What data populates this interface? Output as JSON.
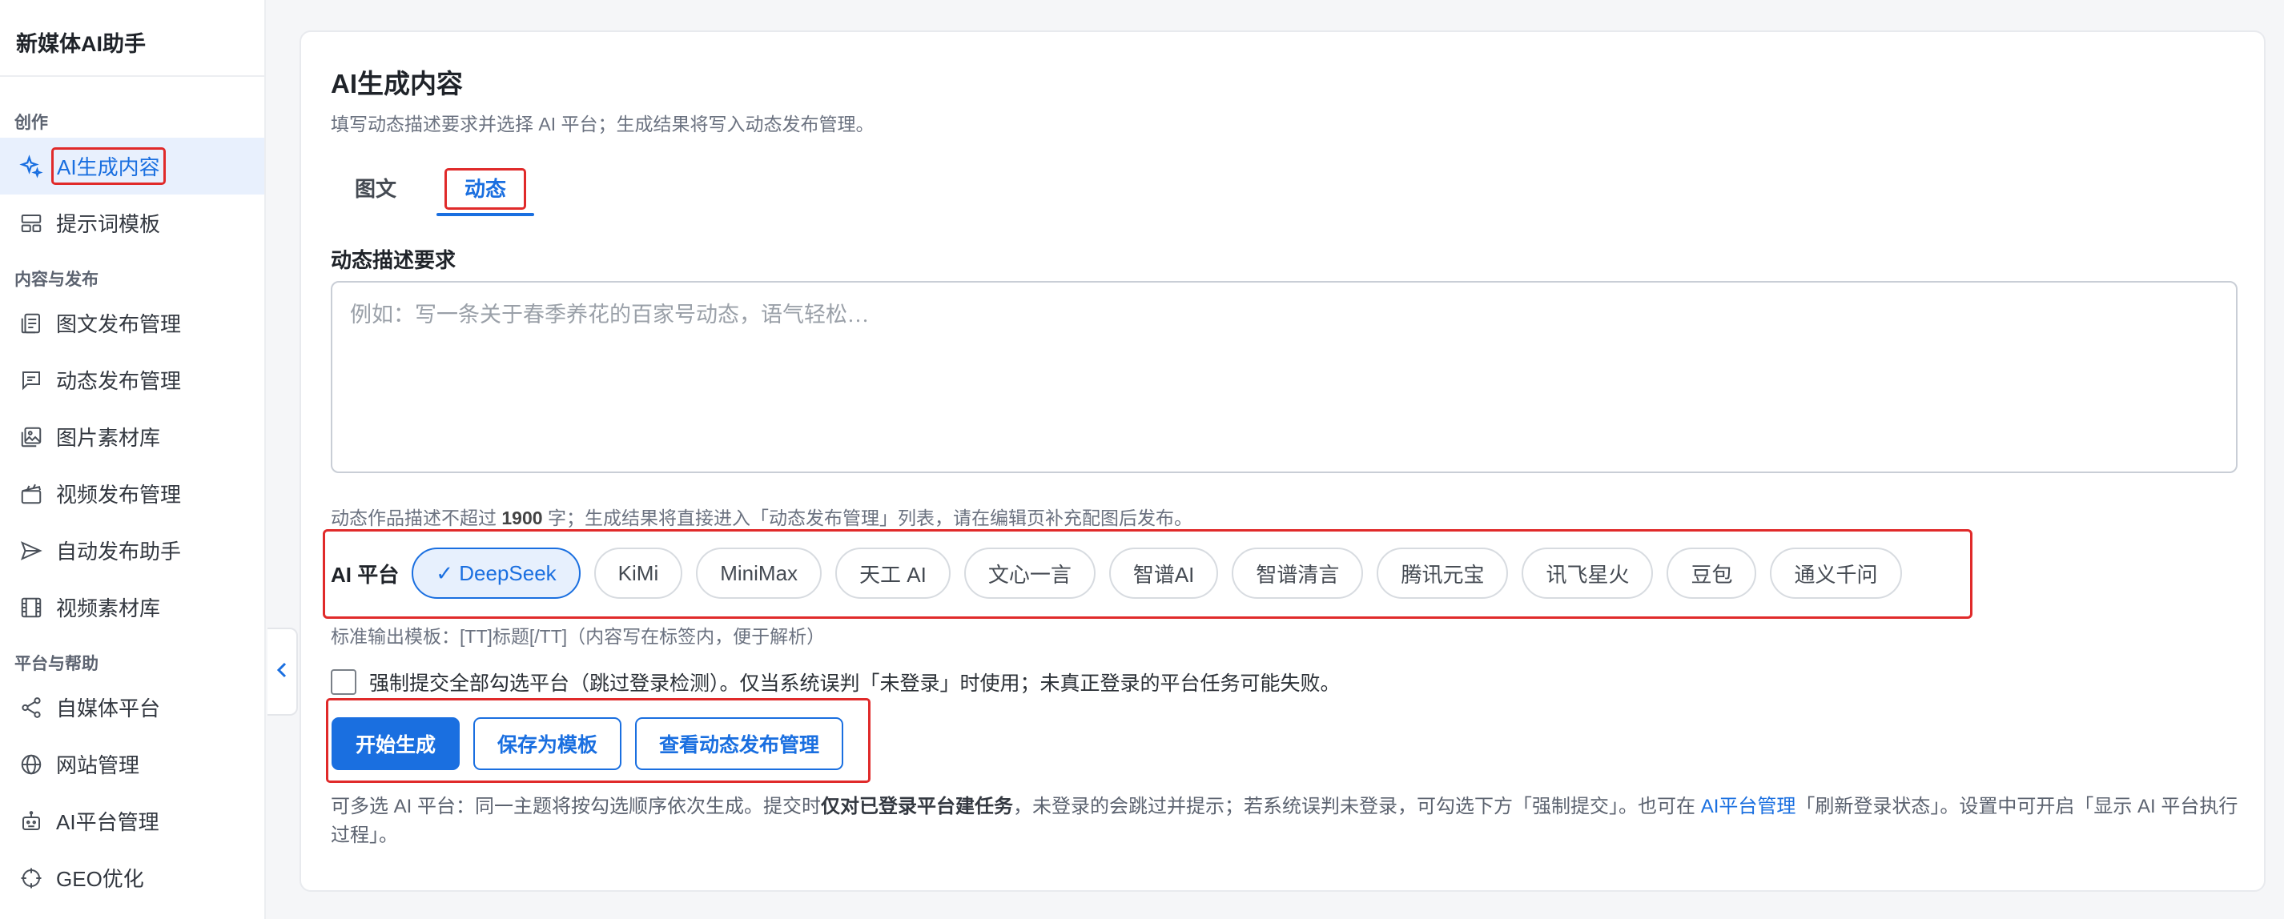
{
  "app_title": "新媒体AI助手",
  "sidebar": {
    "groups": [
      {
        "label": "创作",
        "items": [
          {
            "label": "AI生成内容",
            "icon": "sparkle-icon",
            "active": true
          },
          {
            "label": "提示词模板",
            "icon": "template-icon"
          }
        ]
      },
      {
        "label": "内容与发布",
        "items": [
          {
            "label": "图文发布管理",
            "icon": "document-icon"
          },
          {
            "label": "动态发布管理",
            "icon": "message-icon"
          },
          {
            "label": "图片素材库",
            "icon": "image-icon"
          },
          {
            "label": "视频发布管理",
            "icon": "clapper-icon"
          },
          {
            "label": "自动发布助手",
            "icon": "send-icon"
          },
          {
            "label": "视频素材库",
            "icon": "film-icon"
          }
        ]
      },
      {
        "label": "平台与帮助",
        "items": [
          {
            "label": "自媒体平台",
            "icon": "share-icon"
          },
          {
            "label": "网站管理",
            "icon": "globe-icon"
          },
          {
            "label": "AI平台管理",
            "icon": "robot-icon"
          },
          {
            "label": "GEO优化",
            "icon": "crosshair-icon"
          }
        ]
      }
    ]
  },
  "main": {
    "title": "AI生成内容",
    "subtitle": "填写动态描述要求并选择 AI 平台；生成结果将写入动态发布管理。",
    "tabs": [
      {
        "label": "图文",
        "active": false
      },
      {
        "label": "动态",
        "active": true
      }
    ],
    "field_label": "动态描述要求",
    "textarea_placeholder": "例如：写一条关于春季养花的百家号动态，语气轻松…",
    "hint_prefix": "动态作品描述不超过 ",
    "hint_limit": "1900",
    "hint_suffix": " 字；生成结果将直接进入「动态发布管理」列表，请在编辑页补充配图后发布。",
    "platform_label": "AI 平台",
    "platforms": [
      {
        "label": "✓ DeepSeek",
        "selected": true
      },
      {
        "label": "KiMi",
        "selected": false
      },
      {
        "label": "MiniMax",
        "selected": false
      },
      {
        "label": "天工 AI",
        "selected": false
      },
      {
        "label": "文心一言",
        "selected": false
      },
      {
        "label": "智谱AI",
        "selected": false
      },
      {
        "label": "智谱清言",
        "selected": false
      },
      {
        "label": "腾讯元宝",
        "selected": false
      },
      {
        "label": "讯飞星火",
        "selected": false
      },
      {
        "label": "豆包",
        "selected": false
      },
      {
        "label": "通义千问",
        "selected": false
      }
    ],
    "output_template_hint": "标准输出模板：[TT]标题[/TT]（内容写在标签内，便于解析）",
    "force_submit_label": "强制提交全部勾选平台（跳过登录检测）。仅当系统误判「未登录」时使用；未真正登录的平台任务可能失败。",
    "force_submit_checked": false,
    "buttons": {
      "start": "开始生成",
      "save_template": "保存为模板",
      "view_manage": "查看动态发布管理"
    },
    "footer": {
      "part1": "可多选 AI 平台：同一主题将按勾选顺序依次生成。提交时",
      "bold": "仅对已登录平台建任务",
      "part2": "，未登录的会跳过并提示；若系统误判未登录，可勾选下方「强制提交」。也可在 ",
      "link": "AI平台管理",
      "part3": "「刷新登录状态」。设置中可开启「显示 AI 平台执行过程」。"
    }
  },
  "colors": {
    "accent": "#1a6fe0",
    "highlight_box": "#e02a2a",
    "active_nav_bg": "#e8f0fd"
  }
}
